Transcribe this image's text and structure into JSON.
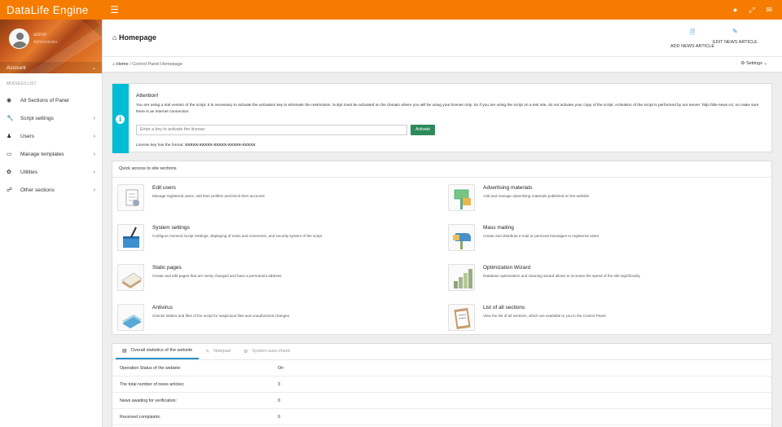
{
  "app": {
    "brand": "DataLife Engine"
  },
  "topbar": {
    "hamburger_icon": "menu-icon",
    "icons": [
      "globe-icon",
      "expand-icon",
      "envelope-icon"
    ]
  },
  "user": {
    "name": "admin",
    "role": "Administrator",
    "account_label": "Account"
  },
  "sidebar": {
    "modules_title": "MODULES LIST",
    "items": [
      {
        "label": "All Sections of Panel",
        "icon": "globe-icon",
        "arrow": false
      },
      {
        "label": "Script settings",
        "icon": "wrench-icon",
        "arrow": true
      },
      {
        "label": "Users",
        "icon": "user-icon",
        "arrow": true
      },
      {
        "label": "Manage templates",
        "icon": "laptop-icon",
        "arrow": true
      },
      {
        "label": "Utilities",
        "icon": "leaf-icon",
        "arrow": true
      },
      {
        "label": "Other sections",
        "icon": "link-icon",
        "arrow": true
      }
    ]
  },
  "header": {
    "title": "Homepage",
    "add_news": "ADD NEWS ARTICLE",
    "edit_news": "EDIT NEWS ARTICLE"
  },
  "breadcrumb": {
    "home": "Home",
    "separator": "/",
    "current": "Control Panel Homepage",
    "settings": "Settings"
  },
  "alert": {
    "title": "Attention!",
    "text": "You are using a trial version of the script. It is necessary to activate the activation key to eliminate the restrictions. Script must be activated on the domain where you will be using your license only. So if you are using the script on a test site, do not activate your copy of the script. Activation of the script is performed by our server: http://dle-news.ru/, so make sure there is an internet connection.",
    "input_placeholder": "Enter a key to activate the license:",
    "activate_button": "Activate",
    "format_label": "License key has the format:",
    "format_value": "XXXXX-XXXXX-XXXXX-XXXXX-XXXXX"
  },
  "quick": {
    "title": "Quick access to site sections",
    "items": [
      {
        "title": "Edit users",
        "desc": "Manage registered users, edit their profiles and block their accounts",
        "icon": "users-doc-icon"
      },
      {
        "title": "Advertising materials",
        "desc": "Add and manage advertising materials published on the website",
        "icon": "billboard-icon"
      },
      {
        "title": "System settings",
        "desc": "Configure General Script Settings, displaying of news and comments, and security system of the script",
        "icon": "toolbox-icon"
      },
      {
        "title": "Mass mailing",
        "desc": "Create and distribute e-mail or personal messages to registered users",
        "icon": "mailbox-icon"
      },
      {
        "title": "Static pages",
        "desc": "Create and edit pages that are rarely changed and have a permanent address",
        "icon": "papers-icon"
      },
      {
        "title": "Optimization Wizard",
        "desc": "Database optimization and cleaning wizard allows to increase the speed of the site significantly",
        "icon": "bars-icon"
      },
      {
        "title": "Antivirus",
        "desc": "Checks folders and files of the script for suspicious files and unauthorized changes",
        "icon": "shield-doc-icon"
      },
      {
        "title": "List of all sections",
        "desc": "View the list of all sections, which are available to you in the Control Panel.",
        "icon": "clipboard-icon"
      }
    ]
  },
  "stats": {
    "tabs": [
      {
        "label": "Overall statistics of the website",
        "icon": "chart-icon"
      },
      {
        "label": "Notepad",
        "icon": "edit-icon"
      },
      {
        "label": "System auto-check",
        "icon": "gear-icon"
      }
    ],
    "rows": [
      {
        "label": "Operation Status of the website:",
        "value": "On"
      },
      {
        "label": "The total number of news articles:",
        "value": "3"
      },
      {
        "label": "News awaiting for verification:",
        "value": "0"
      },
      {
        "label": "Received complaints:",
        "value": "0"
      }
    ]
  }
}
